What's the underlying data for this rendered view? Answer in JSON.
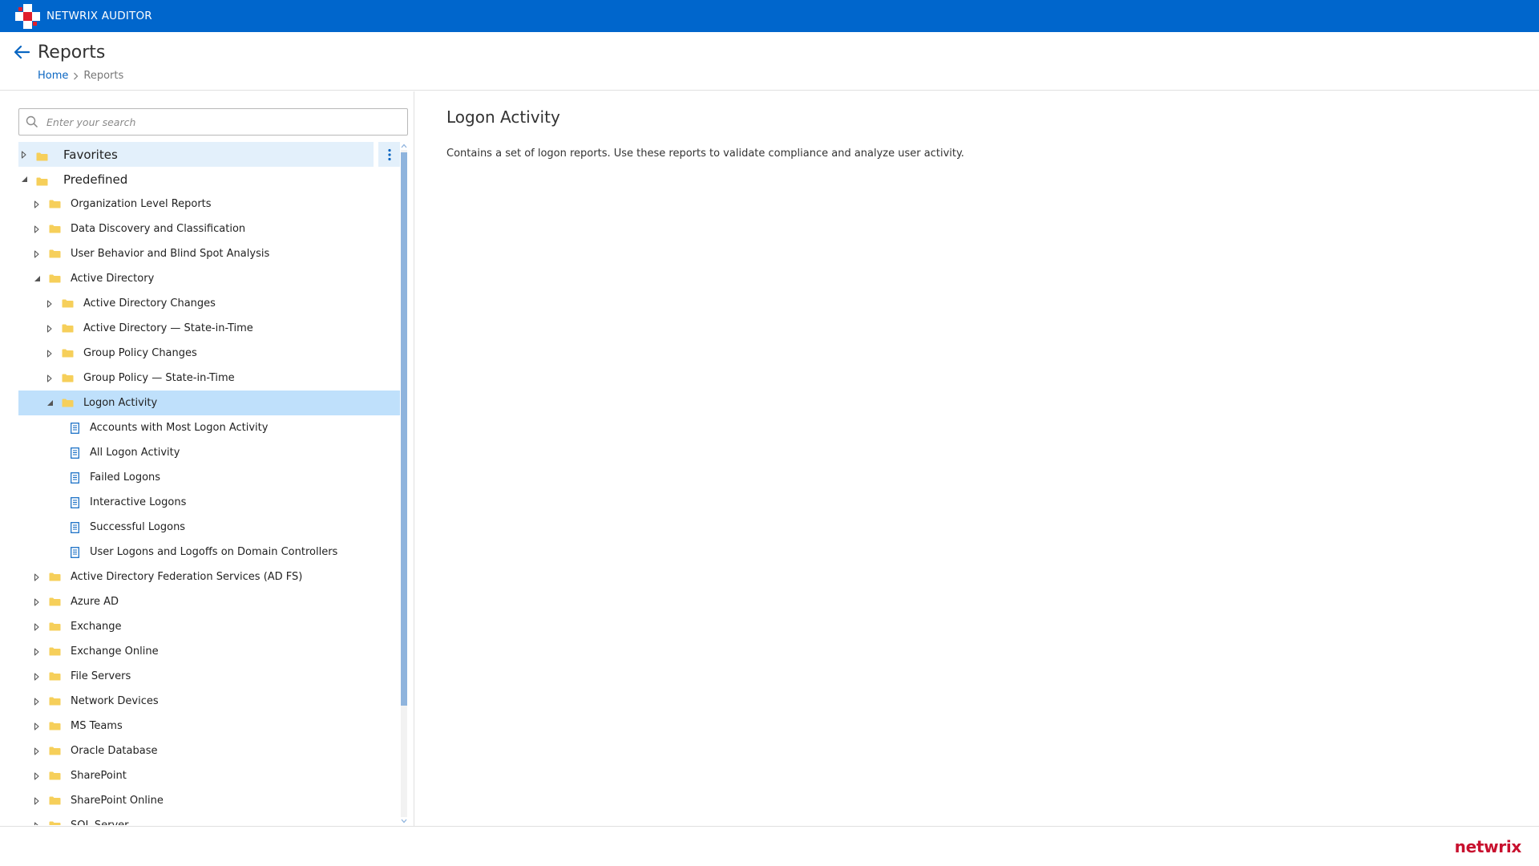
{
  "app": {
    "title": "NETWRIX AUDITOR",
    "brand": "netwrix"
  },
  "colors": {
    "topbar": "#0066cc",
    "accent_link": "#0a66c2",
    "selected_row": "#bfe0fb",
    "favorites_row": "#e3f0fb",
    "folder": "#f6cf5a",
    "brand": "#c8102e"
  },
  "header": {
    "page_title": "Reports",
    "breadcrumb": {
      "home": "Home",
      "current": "Reports"
    }
  },
  "search": {
    "placeholder": "Enter your search",
    "value": ""
  },
  "tree": {
    "favorites": "Favorites",
    "predefined": "Predefined",
    "level1_before": [
      "Organization Level Reports",
      "Data Discovery and Classification",
      "User Behavior and Blind Spot Analysis"
    ],
    "active_directory": "Active Directory",
    "ad_children": [
      "Active Directory Changes",
      "Active Directory — State-in-Time",
      "Group Policy Changes",
      "Group Policy — State-in-Time"
    ],
    "logon_activity": "Logon Activity",
    "logon_reports": [
      "Accounts with Most Logon Activity",
      "All Logon Activity",
      "Failed Logons",
      "Interactive Logons",
      "Successful Logons",
      "User Logons and Logoffs on Domain Controllers"
    ],
    "level1_after": [
      "Active Directory Federation Services (AD FS)",
      "Azure AD",
      "Exchange",
      "Exchange Online",
      "File Servers",
      "Network Devices",
      "MS Teams",
      "Oracle Database",
      "SharePoint",
      "SharePoint Online",
      "SQL Server"
    ]
  },
  "content": {
    "title": "Logon Activity",
    "description": "Contains a set of logon reports. Use these reports to validate compliance and analyze user activity."
  }
}
